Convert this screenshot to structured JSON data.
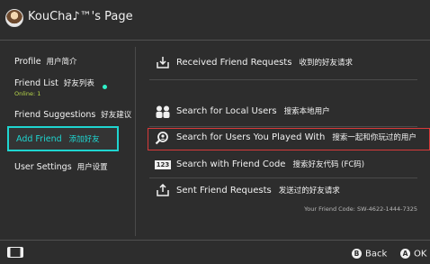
{
  "header": {
    "title": "KouCha♪™'s Page",
    "avatar_icon": "user-avatar"
  },
  "sidebar": {
    "items": [
      {
        "label": "Profile",
        "label_zh": "用户简介"
      },
      {
        "label": "Friend List",
        "label_zh": "好友列表",
        "status": "Online: 1"
      },
      {
        "label": "Friend Suggestions",
        "label_zh": "好友建议"
      },
      {
        "label": "Add Friend",
        "label_zh": "添加好友",
        "selected": true
      },
      {
        "label": "User Settings",
        "label_zh": "用户设置"
      }
    ]
  },
  "main": {
    "options": [
      {
        "icon": "inbox-download-icon",
        "label": "Received Friend Requests",
        "label_zh": "收到的好友请求"
      },
      {
        "icon": "people-icon",
        "label": "Search for Local Users",
        "label_zh": "搜索本地用户"
      },
      {
        "icon": "search-person-icon",
        "label": "Search for Users You Played With",
        "label_zh": "搜索一起和你玩过的用户",
        "highlighted": true
      },
      {
        "icon": "number-123-icon",
        "label": "Search with Friend Code",
        "label_zh": "搜索好友代码 (FC码)",
        "icon_text": "123"
      },
      {
        "icon": "outbox-upload-icon",
        "label": "Sent Friend Requests",
        "label_zh": "发送过的好友请求"
      }
    ],
    "friend_code": "Your Friend Code: SW-4622-1444-7325"
  },
  "footer": {
    "back_glyph": "B",
    "back_label": "Back",
    "ok_glyph": "A",
    "ok_label": "OK",
    "controller_icon": "handheld-console-icon"
  },
  "colors": {
    "background": "#2d2d2d",
    "accent": "#1fd5d0",
    "highlight_border": "#d83a3a",
    "online": "#b9d84a"
  }
}
